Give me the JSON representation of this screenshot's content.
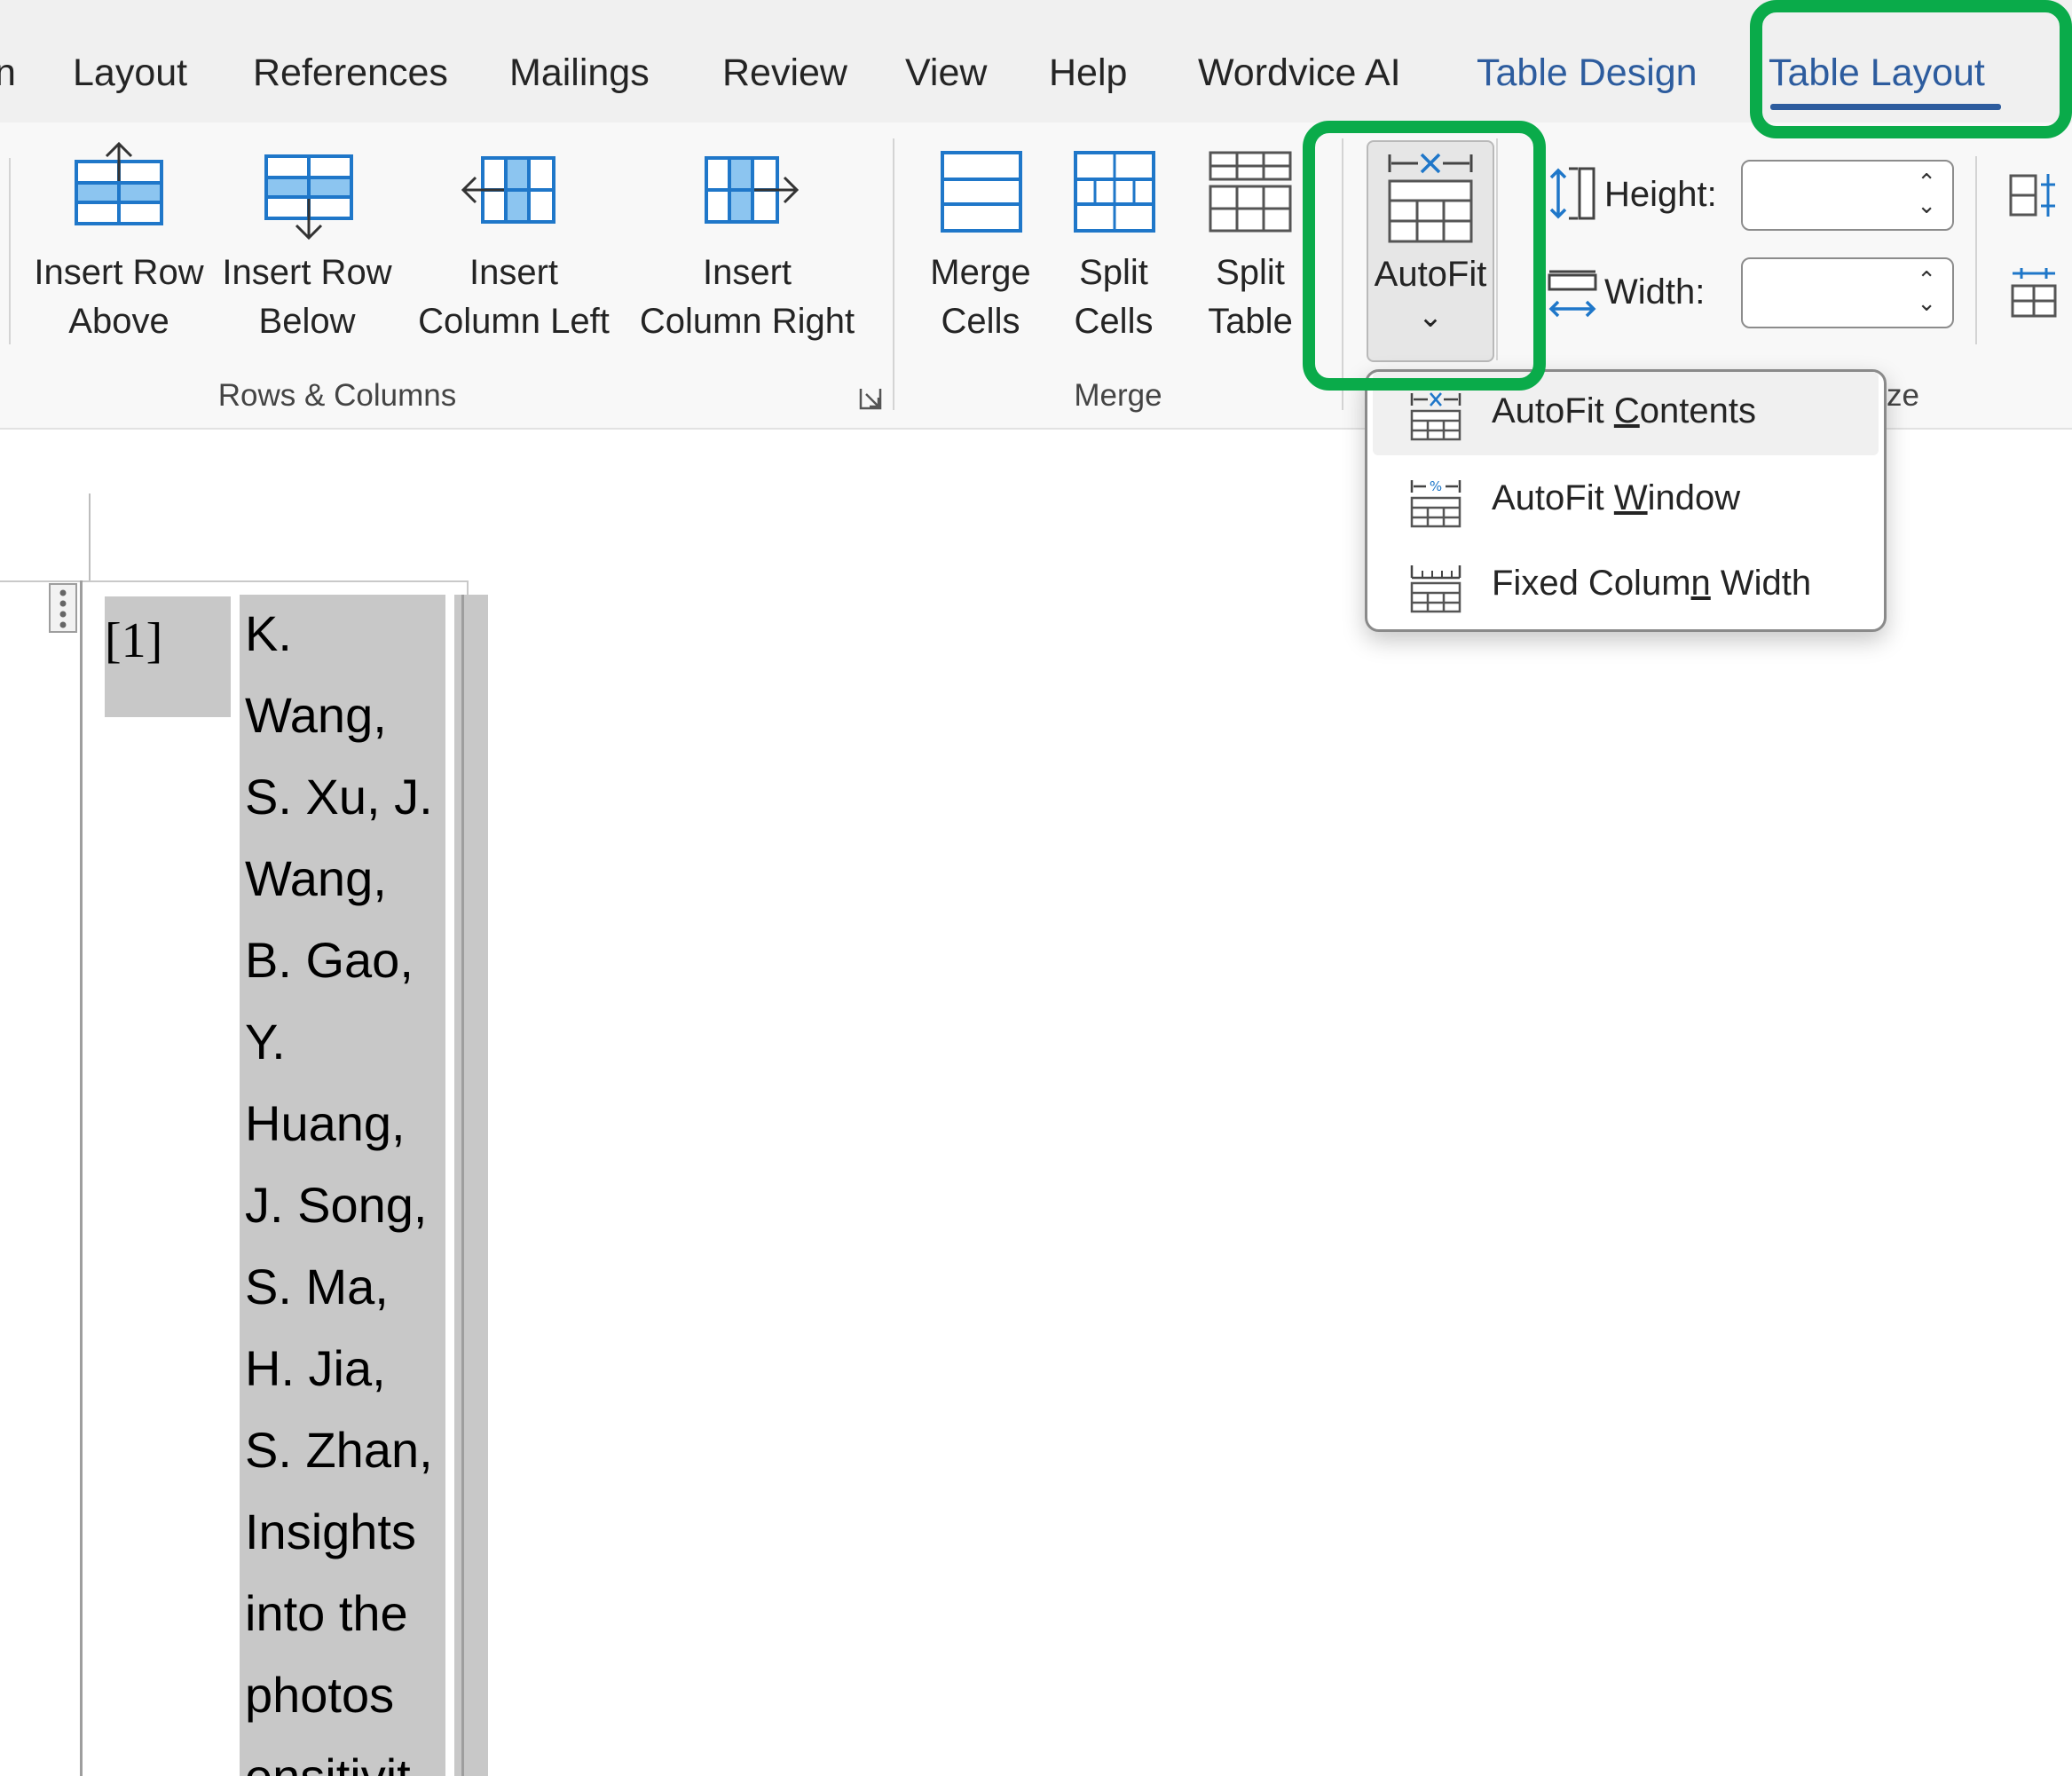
{
  "tabs": [
    {
      "label": "n",
      "contextual": false
    },
    {
      "label": "Layout",
      "contextual": false
    },
    {
      "label": "References",
      "contextual": false
    },
    {
      "label": "Mailings",
      "contextual": false
    },
    {
      "label": "Review",
      "contextual": false
    },
    {
      "label": "View",
      "contextual": false
    },
    {
      "label": "Help",
      "contextual": false
    },
    {
      "label": "Wordvice AI",
      "contextual": false
    },
    {
      "label": "Table Design",
      "contextual": true
    },
    {
      "label": "Table Layout",
      "contextual": true,
      "active": true
    }
  ],
  "ribbon": {
    "rows_columns": {
      "group_label": "Rows & Columns",
      "insert_row_above": [
        "Insert Row",
        "Above"
      ],
      "insert_row_below": [
        "Insert Row",
        "Below"
      ],
      "insert_column_left": [
        "Insert",
        "Column Left"
      ],
      "insert_column_right": [
        "Insert",
        "Column Right"
      ]
    },
    "merge": {
      "group_label": "Merge",
      "merge_cells": [
        "Merge",
        "Cells"
      ],
      "split_cells": [
        "Split",
        "Cells"
      ],
      "split_table": [
        "Split",
        "Table"
      ]
    },
    "cell_size": {
      "autofit_label": "AutoFit",
      "autofit_chevron": "⌄",
      "height_label": "Height:",
      "width_label": "Width:",
      "height_value": "",
      "width_value": "",
      "group_label_partial": "ze"
    }
  },
  "autofit_menu": {
    "items": [
      {
        "pre": "AutoFit ",
        "key": "C",
        "post": "ontents",
        "icon": "autofit-contents-icon"
      },
      {
        "pre": "AutoFit ",
        "key": "W",
        "post": "indow",
        "icon": "autofit-window-icon"
      },
      {
        "pre": "Fixed Colum",
        "key": "n",
        "post": " Width",
        "icon": "fixed-column-width-icon"
      }
    ]
  },
  "document": {
    "ref_number": "[1]",
    "ref_lines": [
      "K.",
      "Wang,",
      "S. Xu, J.",
      "Wang,",
      "B. Gao,",
      "Y.",
      "Huang,",
      "J. Song,",
      "S. Ma,",
      "H. Jia,",
      "S. Zhan,",
      "Insights",
      "into the",
      "photos",
      "ensitivit"
    ]
  },
  "colors": {
    "highlight": "#0aab4a",
    "contextual_tab": "#2d5c9e",
    "selection": "#c8c8c8",
    "icon_blue": "#1f77c9",
    "icon_fill": "#8cc5f0"
  }
}
